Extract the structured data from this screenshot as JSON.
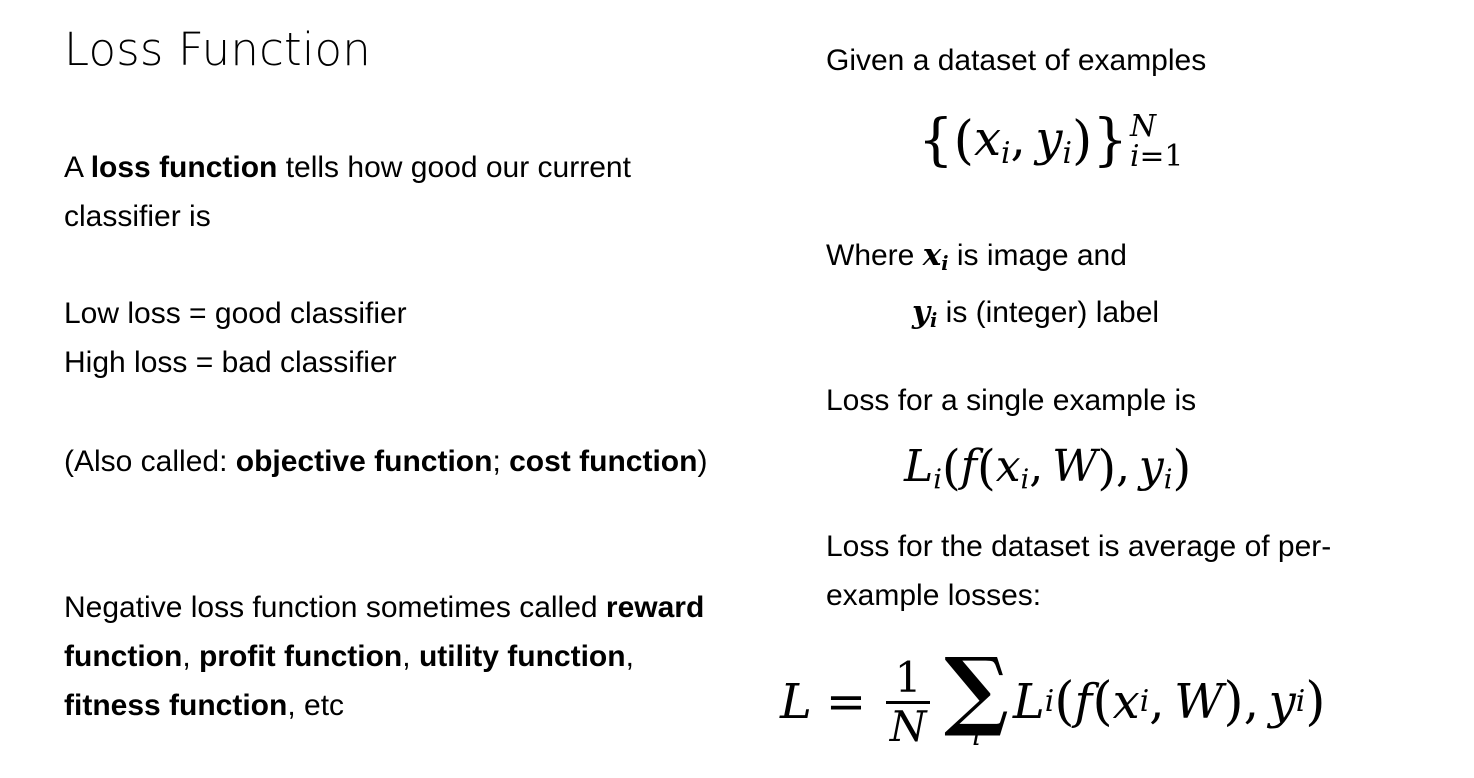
{
  "slide": {
    "background_color": "#ffffff",
    "text_color": "#000000",
    "title": "Loss Function"
  },
  "left_column": {
    "paragraphs": [
      {
        "id": "intro",
        "runs": [
          {
            "text": "A ",
            "bold": false
          },
          {
            "text": "loss function",
            "bold": true
          },
          {
            "text": " tells how good our current classifier is",
            "bold": false
          }
        ],
        "plain": "A loss function tells how good our current classifier is"
      },
      {
        "id": "low-high",
        "lines": [
          "Low loss = good classifier",
          "High loss = bad classifier"
        ],
        "plain": "Low loss = good classifier\nHigh loss = bad classifier"
      },
      {
        "id": "also-called",
        "runs": [
          {
            "text": "(Also called: ",
            "bold": false
          },
          {
            "text": "objective function",
            "bold": true
          },
          {
            "text": "; ",
            "bold": false
          },
          {
            "text": "cost function",
            "bold": true
          },
          {
            "text": ")",
            "bold": false
          }
        ],
        "plain": "(Also called: objective function; cost function)"
      },
      {
        "id": "negative",
        "runs": [
          {
            "text": "Negative loss function sometimes called ",
            "bold": false
          },
          {
            "text": "reward function",
            "bold": true
          },
          {
            "text": ", ",
            "bold": false
          },
          {
            "text": "profit function",
            "bold": true
          },
          {
            "text": ", ",
            "bold": false
          },
          {
            "text": "utility function",
            "bold": true
          },
          {
            "text": ", ",
            "bold": false
          },
          {
            "text": "fitness function",
            "bold": true
          },
          {
            "text": ", etc",
            "bold": false
          }
        ],
        "plain": "Negative loss function sometimes called reward function, profit function, utility function, fitness function, etc"
      }
    ]
  },
  "right_column": {
    "given_label": "Given a dataset of examples",
    "where_line_1_prefix": "Where ",
    "where_line_1_var": "x",
    "where_line_1_var_sub": "i",
    "where_line_1_suffix": " is image and",
    "where_line_2_var": "y",
    "where_line_2_var_sub": "i",
    "where_line_2_suffix": " is (integer) label",
    "loss_single_label": "Loss for a single example is",
    "loss_dataset_label": "Loss for the dataset is average of per-example losses:"
  },
  "formulas": {
    "dataset": {
      "latex": "\\{(x_i, y_i)\\}_{i=1}^{N}",
      "plain": "{(x_i, y_i)}_{i=1}^{N}",
      "open_brace": "{",
      "open_paren": "(",
      "x": "x",
      "x_sub": "i",
      "comma": ",",
      "y": "y",
      "y_sub": "i",
      "close_paren": ")",
      "close_brace": "}",
      "sup": "N",
      "sub_var": "i",
      "sub_eq": "=",
      "sub_val": "1"
    },
    "loss_single": {
      "latex": "L_i(f(x_i, W), y_i)",
      "plain": "L_i(f(x_i, W), y_i)",
      "L": "L",
      "L_sub": "i",
      "open_paren_1": "(",
      "f": "f",
      "open_paren_2": "(",
      "x": "x",
      "x_sub": "i",
      "comma_1": ",",
      "W": "W",
      "close_paren_2": ")",
      "comma_2": ",",
      "y": "y",
      "y_sub": "i",
      "close_paren_1": ")"
    },
    "loss_total": {
      "latex": "L = \\frac{1}{N}\\sum_i L_i(f(x_i, W), y_i)",
      "plain": "L = (1/N) sum_i L_i(f(x_i, W), y_i)",
      "L_lhs": "L",
      "equals": "=",
      "frac_num": "1",
      "frac_den": "N",
      "sigma": "∑",
      "sum_index": "i",
      "L": "L",
      "L_sub": "i",
      "open_paren_1": "(",
      "f": "f",
      "open_paren_2": "(",
      "x": "x",
      "x_sub": "i",
      "comma_1": ",",
      "W": "W",
      "close_paren_2": ")",
      "comma_2": ",",
      "y": "y",
      "y_sub": "i",
      "close_paren_1": ")"
    }
  }
}
